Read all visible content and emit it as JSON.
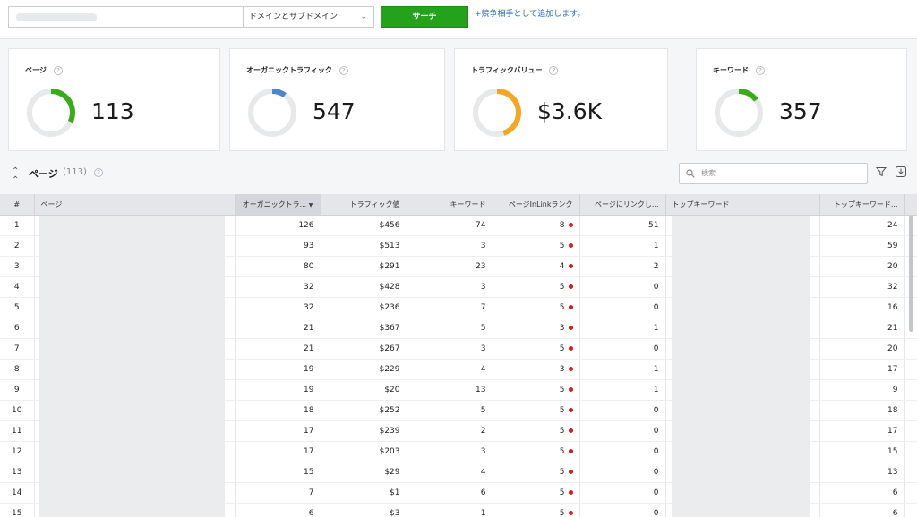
{
  "search": {
    "scope_value": "ドメインとサブドメイン",
    "button_label": "サーチ",
    "add_competitor_label": "+競争相手として追加します。"
  },
  "cards": [
    {
      "title": "ページ",
      "value": "113",
      "fill": 0.32,
      "color": "#3aab1a"
    },
    {
      "title": "オーガニックトラフィック",
      "value": "547",
      "fill": 0.1,
      "color": "#4a86c9"
    },
    {
      "title": "トラフィックバリュー",
      "value": "$3.6K",
      "fill": 0.45,
      "color": "#f5a623"
    },
    {
      "title": "キーワード",
      "value": "357",
      "fill": 0.15,
      "color": "#3aab1a"
    }
  ],
  "section": {
    "title": "ページ",
    "count": "(113)",
    "search_placeholder": "検索"
  },
  "table": {
    "columns": [
      "#",
      "ページ",
      "オーガニックトラ...",
      "トラフィック値",
      "キーワード",
      "ページInLinkランク",
      "ページにリンクし...",
      "トップキーワード",
      "トップキーワード..."
    ],
    "rows": [
      [
        "1",
        "126",
        "$456",
        "74",
        "8",
        "51",
        "24"
      ],
      [
        "2",
        "93",
        "$513",
        "3",
        "5",
        "1",
        "59"
      ],
      [
        "3",
        "80",
        "$291",
        "23",
        "4",
        "2",
        "20"
      ],
      [
        "4",
        "32",
        "$428",
        "3",
        "5",
        "0",
        "32"
      ],
      [
        "5",
        "32",
        "$236",
        "7",
        "5",
        "0",
        "16"
      ],
      [
        "6",
        "21",
        "$367",
        "5",
        "3",
        "1",
        "21"
      ],
      [
        "7",
        "21",
        "$267",
        "3",
        "5",
        "0",
        "20"
      ],
      [
        "8",
        "19",
        "$229",
        "4",
        "3",
        "1",
        "17"
      ],
      [
        "9",
        "19",
        "$20",
        "13",
        "5",
        "1",
        "9"
      ],
      [
        "10",
        "18",
        "$252",
        "5",
        "5",
        "0",
        "18"
      ],
      [
        "11",
        "17",
        "$239",
        "2",
        "5",
        "0",
        "17"
      ],
      [
        "12",
        "17",
        "$203",
        "3",
        "5",
        "0",
        "15"
      ],
      [
        "13",
        "15",
        "$29",
        "4",
        "5",
        "0",
        "13"
      ],
      [
        "14",
        "7",
        "$1",
        "6",
        "5",
        "0",
        "6"
      ],
      [
        "15",
        "6",
        "$3",
        "1",
        "5",
        "0",
        "6"
      ]
    ]
  }
}
